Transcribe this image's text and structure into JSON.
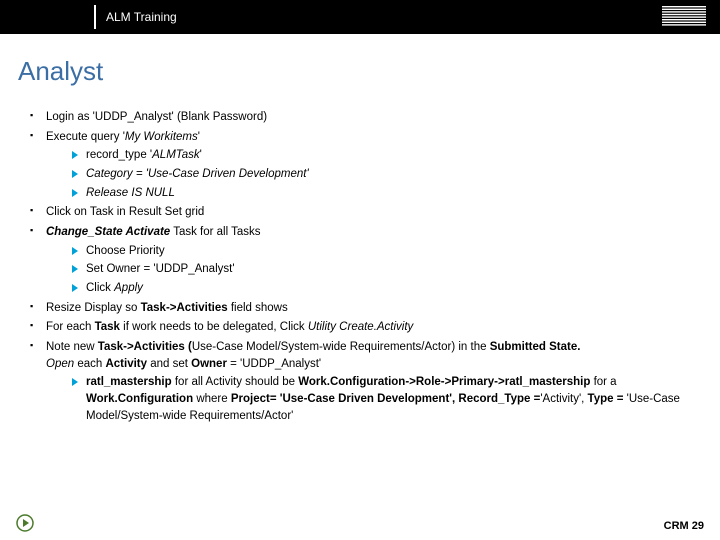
{
  "header": {
    "title": "ALM Training",
    "logo_alt": "IBM"
  },
  "slide": {
    "title": "Analyst"
  },
  "bullets": {
    "b1": "Login as 'UDDP_Analyst' (Blank Password)",
    "b2_prefix": "Execute query '",
    "b2_em": "My Workitems",
    "b2_suffix": "'",
    "b2_sub": {
      "s1_prefix": "record_type '",
      "s1_em": "ALMTask",
      "s1_suffix": "'",
      "s2": "Category = 'Use-Case Driven Development'",
      "s3": "Release IS NULL"
    },
    "b3": "Click on Task in Result Set grid",
    "b4_strong": "Change_State Activate",
    "b4_rest": " Task for all Tasks",
    "b4_sub": {
      "s1": "Choose Priority",
      "s2": "Set Owner = 'UDDP_Analyst'",
      "s3_prefix": "Click ",
      "s3_em": "Apply"
    },
    "b5_prefix": "Resize Display so ",
    "b5_strong": "Task->Activities",
    "b5_suffix": " field shows",
    "b6_prefix": "For each ",
    "b6_strong": "Task",
    "b6_mid": " if work needs to be delegated, Click ",
    "b6_em": "Utility Create.Activity",
    "b7_prefix": "Note new ",
    "b7_strong1": "Task->Activities (",
    "b7_mid1": "Use-Case Model/System-wide Requirements/Actor) in the ",
    "b7_strong2": "Submitted State.",
    "b7_line2_em1": "Open",
    "b7_line2_mid": " each ",
    "b7_line2_strong": "Activity",
    "b7_line2_rest": " and set ",
    "b7_line2_strong2": "Owner",
    "b7_line2_end": " = 'UDDP_Analyst'",
    "b7_sub": {
      "s1_strong1": "ratl_mastership",
      "s1_mid1": " for all Activity should be ",
      "s1_strong2": "Work.Configuration->Role->Primary->ratl_mastership",
      "s1_mid2": " for a ",
      "s1_strong3": "Work.Configuration",
      "s1_mid3": " where ",
      "s1_strong4": "Project= 'Use-Case Driven Development', Record_Type =",
      "s1_end": "'Activity', ",
      "s1_strong5": "Type = ",
      "s1_end2": "'Use-Case Model/System-wide Requirements/Actor'"
    }
  },
  "footer": {
    "label": "CRM 29"
  }
}
